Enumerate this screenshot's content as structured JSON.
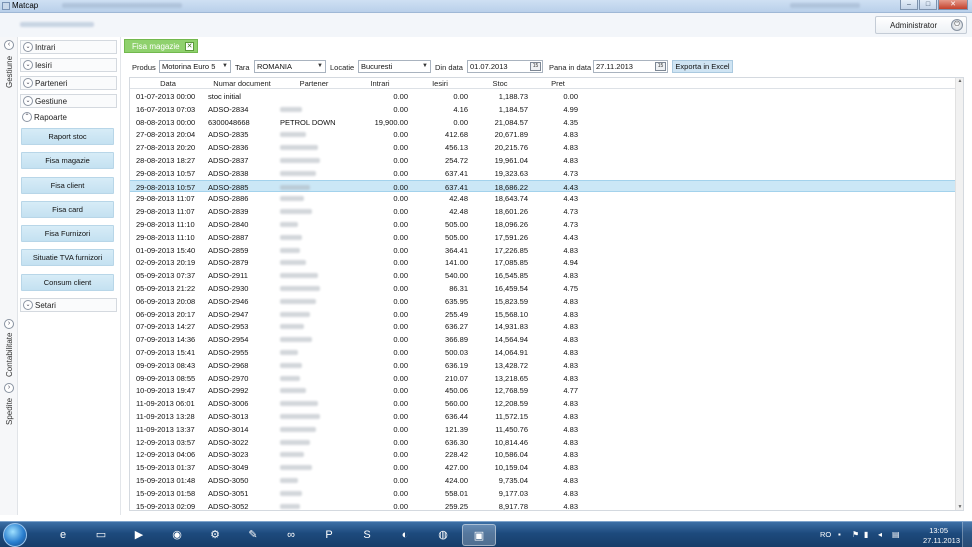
{
  "window": {
    "title": "Matcap"
  },
  "header": {
    "user_button": "Administrator"
  },
  "vtabs": [
    {
      "label": "Gestiune"
    },
    {
      "label": "Contabilitate"
    },
    {
      "label": "Spedite"
    }
  ],
  "sidebar": {
    "items": [
      {
        "label": "Intrari"
      },
      {
        "label": "Iesiri"
      },
      {
        "label": "Parteneri"
      },
      {
        "label": "Gestiune"
      },
      {
        "label": "Rapoarte"
      },
      {
        "label": "Setari"
      }
    ],
    "reports": [
      {
        "label": "Raport stoc"
      },
      {
        "label": "Fisa magazie"
      },
      {
        "label": "Fisa client"
      },
      {
        "label": "Fisa card"
      },
      {
        "label": "Fisa Furnizori"
      },
      {
        "label": "Situatie TVA furnizori"
      },
      {
        "label": "Consum client"
      }
    ]
  },
  "tab": {
    "label": "Fisa magazie",
    "close": "✕"
  },
  "filters": {
    "product_label": "Produs",
    "product_value": "Motorina Euro 5",
    "country_label": "Tara",
    "country_value": "ROMANIA",
    "location_label": "Locatie",
    "location_value": "Bucuresti",
    "from_label": "Din data",
    "from_value": "01.07.2013",
    "to_label": "Pana in data",
    "to_value": "27.11.2013",
    "export_label": "Exporta in Excel",
    "calendar_glyph": "15"
  },
  "table": {
    "columns": [
      "Data",
      "Numar document",
      "Partener",
      "Intrari",
      "Iesiri",
      "Stoc",
      "Pret"
    ],
    "rows": [
      {
        "data": "01-07-2013 00:00",
        "doc": "stoc initial",
        "partner_blur": false,
        "intrari": "0.00",
        "iesiri": "0.00",
        "stoc": "1,188.73",
        "pret": "0.00"
      },
      {
        "data": "16-07-2013 07:03",
        "doc": "ADSO-2834",
        "partner_blur": true,
        "intrari": "0.00",
        "iesiri": "4.16",
        "stoc": "1,184.57",
        "pret": "4.99"
      },
      {
        "data": "08-08-2013 00:00",
        "doc": "6300048668",
        "partner": "PETROL DOWN",
        "intrari": "19,900.00",
        "iesiri": "0.00",
        "stoc": "21,084.57",
        "pret": "4.35"
      },
      {
        "data": "27-08-2013 20:04",
        "doc": "ADSO-2835",
        "partner_blur": true,
        "intrari": "0.00",
        "iesiri": "412.68",
        "stoc": "20,671.89",
        "pret": "4.83"
      },
      {
        "data": "27-08-2013 20:20",
        "doc": "ADSO-2836",
        "partner_blur": true,
        "intrari": "0.00",
        "iesiri": "456.13",
        "stoc": "20,215.76",
        "pret": "4.83"
      },
      {
        "data": "28-08-2013 18:27",
        "doc": "ADSO-2837",
        "partner_blur": true,
        "intrari": "0.00",
        "iesiri": "254.72",
        "stoc": "19,961.04",
        "pret": "4.83"
      },
      {
        "data": "29-08-2013 10:57",
        "doc": "ADSO-2838",
        "partner_blur": true,
        "intrari": "0.00",
        "iesiri": "637.41",
        "stoc": "19,323.63",
        "pret": "4.73"
      },
      {
        "data": "29-08-2013 10:57",
        "doc": "ADSO-2885",
        "partner_blur": true,
        "intrari": "0.00",
        "iesiri": "637.41",
        "stoc": "18,686.22",
        "pret": "4.43",
        "selected": true
      },
      {
        "data": "29-08-2013 11:07",
        "doc": "ADSO-2886",
        "partner_blur": true,
        "intrari": "0.00",
        "iesiri": "42.48",
        "stoc": "18,643.74",
        "pret": "4.43"
      },
      {
        "data": "29-08-2013 11:07",
        "doc": "ADSO-2839",
        "partner_blur": true,
        "intrari": "0.00",
        "iesiri": "42.48",
        "stoc": "18,601.26",
        "pret": "4.73"
      },
      {
        "data": "29-08-2013 11:10",
        "doc": "ADSO-2840",
        "partner_blur": true,
        "intrari": "0.00",
        "iesiri": "505.00",
        "stoc": "18,096.26",
        "pret": "4.73"
      },
      {
        "data": "29-08-2013 11:10",
        "doc": "ADSO-2887",
        "partner_blur": true,
        "intrari": "0.00",
        "iesiri": "505.00",
        "stoc": "17,591.26",
        "pret": "4.43"
      },
      {
        "data": "01-09-2013 15:40",
        "doc": "ADSO-2859",
        "partner_blur": true,
        "intrari": "0.00",
        "iesiri": "364.41",
        "stoc": "17,226.85",
        "pret": "4.83"
      },
      {
        "data": "02-09-2013 20:19",
        "doc": "ADSO-2879",
        "partner_blur": true,
        "intrari": "0.00",
        "iesiri": "141.00",
        "stoc": "17,085.85",
        "pret": "4.94"
      },
      {
        "data": "05-09-2013 07:37",
        "doc": "ADSO-2911",
        "partner_blur": true,
        "intrari": "0.00",
        "iesiri": "540.00",
        "stoc": "16,545.85",
        "pret": "4.83"
      },
      {
        "data": "05-09-2013 21:22",
        "doc": "ADSO-2930",
        "partner_blur": true,
        "intrari": "0.00",
        "iesiri": "86.31",
        "stoc": "16,459.54",
        "pret": "4.75"
      },
      {
        "data": "06-09-2013 20:08",
        "doc": "ADSO-2946",
        "partner_blur": true,
        "intrari": "0.00",
        "iesiri": "635.95",
        "stoc": "15,823.59",
        "pret": "4.83"
      },
      {
        "data": "06-09-2013 20:17",
        "doc": "ADSO-2947",
        "partner_blur": true,
        "intrari": "0.00",
        "iesiri": "255.49",
        "stoc": "15,568.10",
        "pret": "4.83"
      },
      {
        "data": "07-09-2013 14:27",
        "doc": "ADSO-2953",
        "partner_blur": true,
        "intrari": "0.00",
        "iesiri": "636.27",
        "stoc": "14,931.83",
        "pret": "4.83"
      },
      {
        "data": "07-09-2013 14:36",
        "doc": "ADSO-2954",
        "partner_blur": true,
        "intrari": "0.00",
        "iesiri": "366.89",
        "stoc": "14,564.94",
        "pret": "4.83"
      },
      {
        "data": "07-09-2013 15:41",
        "doc": "ADSO-2955",
        "partner_blur": true,
        "intrari": "0.00",
        "iesiri": "500.03",
        "stoc": "14,064.91",
        "pret": "4.83"
      },
      {
        "data": "09-09-2013 08:43",
        "doc": "ADSO-2968",
        "partner_blur": true,
        "intrari": "0.00",
        "iesiri": "636.19",
        "stoc": "13,428.72",
        "pret": "4.83"
      },
      {
        "data": "09-09-2013 08:55",
        "doc": "ADSO-2970",
        "partner_blur": true,
        "intrari": "0.00",
        "iesiri": "210.07",
        "stoc": "13,218.65",
        "pret": "4.83"
      },
      {
        "data": "10-09-2013 19:47",
        "doc": "ADSO-2992",
        "partner_blur": true,
        "intrari": "0.00",
        "iesiri": "450.06",
        "stoc": "12,768.59",
        "pret": "4.77"
      },
      {
        "data": "11-09-2013 06:01",
        "doc": "ADSO-3006",
        "partner_blur": true,
        "intrari": "0.00",
        "iesiri": "560.00",
        "stoc": "12,208.59",
        "pret": "4.83"
      },
      {
        "data": "11-09-2013 13:28",
        "doc": "ADSO-3013",
        "partner_blur": true,
        "intrari": "0.00",
        "iesiri": "636.44",
        "stoc": "11,572.15",
        "pret": "4.83"
      },
      {
        "data": "11-09-2013 13:37",
        "doc": "ADSO-3014",
        "partner_blur": true,
        "intrari": "0.00",
        "iesiri": "121.39",
        "stoc": "11,450.76",
        "pret": "4.83"
      },
      {
        "data": "12-09-2013 03:57",
        "doc": "ADSO-3022",
        "partner_blur": true,
        "intrari": "0.00",
        "iesiri": "636.30",
        "stoc": "10,814.46",
        "pret": "4.83"
      },
      {
        "data": "12-09-2013 04:06",
        "doc": "ADSO-3023",
        "partner_blur": true,
        "intrari": "0.00",
        "iesiri": "228.42",
        "stoc": "10,586.04",
        "pret": "4.83"
      },
      {
        "data": "15-09-2013 01:37",
        "doc": "ADSO-3049",
        "partner_blur": true,
        "intrari": "0.00",
        "iesiri": "427.00",
        "stoc": "10,159.04",
        "pret": "4.83"
      },
      {
        "data": "15-09-2013 01:48",
        "doc": "ADSO-3050",
        "partner_blur": true,
        "intrari": "0.00",
        "iesiri": "424.00",
        "stoc": "9,735.04",
        "pret": "4.83"
      },
      {
        "data": "15-09-2013 01:58",
        "doc": "ADSO-3051",
        "partner_blur": true,
        "intrari": "0.00",
        "iesiri": "558.01",
        "stoc": "9,177.03",
        "pret": "4.83"
      },
      {
        "data": "15-09-2013 02:09",
        "doc": "ADSO-3052",
        "partner_blur": true,
        "intrari": "0.00",
        "iesiri": "259.25",
        "stoc": "8,917.78",
        "pret": "4.83"
      }
    ]
  },
  "taskbar": {
    "apps": [
      {
        "icon": "internet-explorer-icon",
        "glyph": "e"
      },
      {
        "icon": "folder-icon",
        "glyph": "▭"
      },
      {
        "icon": "media-player-icon",
        "glyph": "▶"
      },
      {
        "icon": "chrome-icon",
        "glyph": "◉"
      },
      {
        "icon": "network-icon",
        "glyph": "⚙"
      },
      {
        "icon": "tools-icon",
        "glyph": "✎"
      },
      {
        "icon": "visual-studio-icon",
        "glyph": "∞"
      },
      {
        "icon": "powerpoint-icon",
        "glyph": "P"
      },
      {
        "icon": "skype-icon",
        "glyph": "S"
      },
      {
        "icon": "firefox-icon",
        "glyph": "◐"
      },
      {
        "icon": "app-icon",
        "glyph": "◍"
      },
      {
        "icon": "matcap-window-icon",
        "glyph": "▣"
      }
    ],
    "language": "RO",
    "time": "13:05",
    "date": "27.11.2013"
  },
  "colors": {
    "accent_tab": "#8fd16d",
    "report_button": "#c4e1f1",
    "selected_row": "#cbe7f6",
    "taskbar": "#1d4a7d"
  }
}
